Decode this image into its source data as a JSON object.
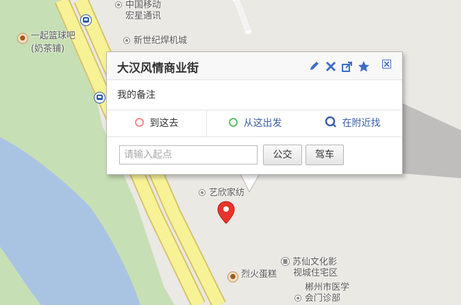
{
  "map": {
    "pois": [
      {
        "id": "zhongguoyidong",
        "icon": "dot",
        "lines": [
          "中国移动",
          "宏星通讯"
        ]
      },
      {
        "id": "basketball",
        "icon": "food",
        "lines": [
          "一起篮球吧",
          "(奶茶铺)"
        ]
      },
      {
        "id": "xinshiji",
        "icon": "dot",
        "lines": [
          "新世纪焊机城"
        ]
      },
      {
        "id": "yixin",
        "icon": "dot",
        "lines": [
          "艺欣家纺"
        ]
      },
      {
        "id": "liehuo",
        "icon": "food",
        "lines": [
          "烈火蛋糕"
        ]
      },
      {
        "id": "suxian",
        "icon": "building",
        "lines": [
          "苏仙文化影",
          "视城住宅区"
        ]
      },
      {
        "id": "chenzhou",
        "icon": "dot",
        "lines": [
          "郴州市医学",
          "会门诊部"
        ]
      }
    ],
    "colors": {
      "ground": "#ebe9e4",
      "park": "#c7dfb5",
      "water": "#a9c4e3",
      "road": "#f7f296",
      "road_edge": "#d6c36c"
    }
  },
  "popup": {
    "title": "大汉风情商业街",
    "tools": [
      "edit-icon",
      "delete-icon",
      "share-icon",
      "favorite-icon",
      "close-icon"
    ],
    "note": "我的备注",
    "tabs": [
      {
        "label": "到这去",
        "ring": "#f08a8a",
        "active": true
      },
      {
        "label": "从这出发",
        "ring": "#5dc064",
        "active": false
      },
      {
        "label": "在附近找",
        "ring": "#3a5da8",
        "active": false
      }
    ],
    "start_placeholder": "请输入起点",
    "bus_label": "公交",
    "drive_label": "驾车"
  }
}
